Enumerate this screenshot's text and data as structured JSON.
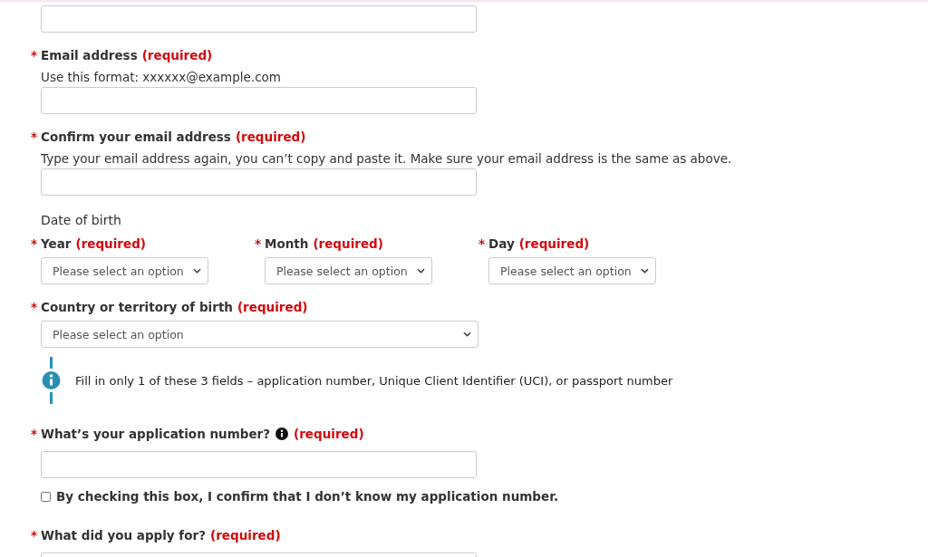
{
  "items": [
    {
      "kind": "input"
    },
    {
      "kind": "input",
      "asterisk": "*",
      "label": "Email address",
      "required": "(required)",
      "hint": "Use this format: xxxxxx@example.com"
    },
    {
      "kind": "input",
      "asterisk": "*",
      "label": "Confirm your email address",
      "required": "(required)",
      "hint": "Type your email address again, you can’t copy and paste it. Make sure your email address is the same as above."
    },
    {
      "kind": "date",
      "heading": "Date of birth",
      "parts": [
        {
          "asterisk": "*",
          "label": "Year",
          "required": "(required)",
          "placeholder": "Please select an option"
        },
        {
          "asterisk": "*",
          "label": "Month",
          "required": "(required)",
          "placeholder": "Please select an option"
        },
        {
          "asterisk": "*",
          "label": "Day",
          "required": "(required)",
          "placeholder": "Please select an option"
        }
      ]
    },
    {
      "kind": "select",
      "asterisk": "*",
      "label": "Country or territory of birth",
      "required": "(required)",
      "placeholder": "Please select an option"
    },
    {
      "kind": "info",
      "text": "Fill in only 1 of these 3 fields – application number, Unique Client Identifier (UCI), or passport number"
    },
    {
      "kind": "input",
      "asterisk": "*",
      "label": "What’s your application number?",
      "info_icon": true,
      "required": "(required)"
    },
    {
      "kind": "checkbox",
      "label": "By checking this box, I confirm that I don’t know my application number.",
      "checked": false
    },
    {
      "kind": "input",
      "asterisk": "*",
      "label": "What did you apply for?",
      "required": "(required)"
    }
  ]
}
